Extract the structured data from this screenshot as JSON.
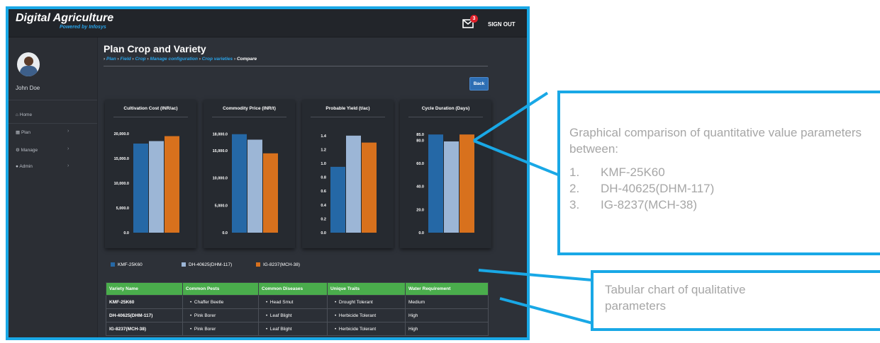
{
  "app": {
    "brand": "Digital Agriculture",
    "brand_sub": "Powered by Infosys",
    "mail_count": "3",
    "signout_label": "SIGN OUT"
  },
  "sidebar": {
    "user_name": "John Doe",
    "items": [
      {
        "label": "Home"
      },
      {
        "label": "Plan"
      },
      {
        "label": "Manage"
      },
      {
        "label": "Admin"
      }
    ]
  },
  "page": {
    "title": "Plan Crop and Variety",
    "breadcrumb": [
      "Plan",
      "Field",
      "Crop",
      "Manage configuration",
      "Crop varieties"
    ],
    "breadcrumb_current": "Compare",
    "back_label": "Back"
  },
  "chart_data": [
    {
      "type": "bar",
      "title": "Cultivation Cost (INR/ac)",
      "categories": [
        "KMF-25K60",
        "DH-40625(DHM-117)",
        "IG-8237(MCH-38)"
      ],
      "values": [
        18000,
        18500,
        19500
      ],
      "ticks": [
        "0.0",
        "5,000.0",
        "10,000.0",
        "15,000.0",
        "20,000.0"
      ],
      "tick_values": [
        0,
        5000,
        10000,
        15000,
        20000
      ],
      "ylim": [
        0,
        21000
      ]
    },
    {
      "type": "bar",
      "title": "Commodity Price (INR/t)",
      "categories": [
        "KMF-25K60",
        "DH-40625(DHM-117)",
        "IG-8237(MCH-38)"
      ],
      "values": [
        18000,
        17000,
        14500
      ],
      "ticks": [
        "0.0",
        "5,000.0",
        "10,000.0",
        "15,000.0",
        "18,000.0"
      ],
      "tick_values": [
        0,
        5000,
        10000,
        15000,
        18000
      ],
      "ylim": [
        0,
        19000
      ]
    },
    {
      "type": "bar",
      "title": "Probable Yield (t/ac)",
      "categories": [
        "KMF-25K60",
        "DH-40625(DHM-117)",
        "IG-8237(MCH-38)"
      ],
      "values": [
        0.95,
        1.4,
        1.3
      ],
      "ticks": [
        "0.0",
        "0.2",
        "0.4",
        "0.6",
        "0.8",
        "1.0",
        "1.2",
        "1.4"
      ],
      "tick_values": [
        0,
        0.2,
        0.4,
        0.6,
        0.8,
        1.0,
        1.2,
        1.4
      ],
      "ylim": [
        0,
        1.5
      ]
    },
    {
      "type": "bar",
      "title": "Cycle Duration (Days)",
      "categories": [
        "KMF-25K60",
        "DH-40625(DHM-117)",
        "IG-8237(MCH-38)"
      ],
      "values": [
        85,
        79,
        85
      ],
      "ticks": [
        "0.0",
        "20.0",
        "40.0",
        "60.0",
        "80.0",
        "85.0"
      ],
      "tick_values": [
        0,
        20,
        40,
        60,
        80,
        85
      ],
      "ylim": [
        0,
        90
      ]
    }
  ],
  "legend": [
    {
      "label": "KMF-25K60",
      "color": "#2568a6"
    },
    {
      "label": "DH-40625(DHM-117)",
      "color": "#9cb6d6"
    },
    {
      "label": "IG-8237(MCH-38)",
      "color": "#d8711d"
    }
  ],
  "table": {
    "headers": [
      "Variety Name",
      "Common Pests",
      "Common Diseases",
      "Unique Traits",
      "Water Requirement"
    ],
    "rows": [
      [
        "KMF-25K60",
        "Chaffer Beetle",
        "Head Smut",
        "Drought Tolerant",
        "Medium"
      ],
      [
        "DH-40625(DHM-117)",
        "Pink Borer",
        "Leaf Blight",
        "Herbicide Tolerant",
        "High"
      ],
      [
        "IG-8237(MCH-38)",
        "Pink Borer",
        "Leaf Blight",
        "Herbicide Tolerant",
        "High"
      ]
    ]
  },
  "callouts": {
    "graphical_intro": "Graphical comparison of quantitative value parameters between:",
    "graphical_items": [
      {
        "num": "1.",
        "text": "KMF-25K60"
      },
      {
        "num": "2.",
        "text": "DH-40625(DHM-117)"
      },
      {
        "num": "3.",
        "text": "IG-8237(MCH-38)"
      }
    ],
    "tabular": "Tabular chart of qualitative parameters"
  },
  "colors": {
    "accent": "#19a8e6",
    "header_green": "#4aad4c"
  }
}
